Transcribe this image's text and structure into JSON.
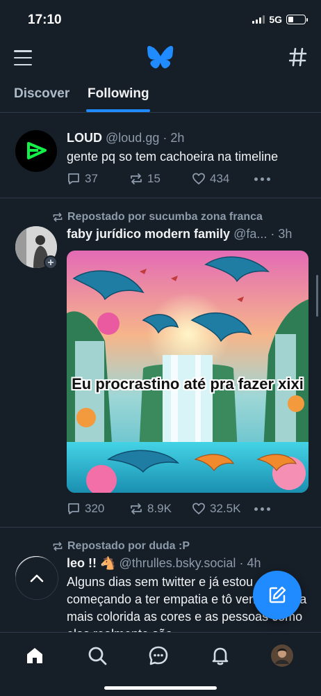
{
  "status_bar": {
    "time": "17:10",
    "network": "5G",
    "battery_level": 0.3
  },
  "header": {
    "menu_icon": "menu-icon",
    "logo_icon": "butterfly-icon",
    "feeds_icon": "hash-icon"
  },
  "tabs": [
    {
      "label": "Discover",
      "active": false
    },
    {
      "label": "Following",
      "active": true
    }
  ],
  "posts": [
    {
      "display_name": "LOUD",
      "handle": "@loud.gg",
      "time": "· 2h",
      "text": "gente pq so tem cachoeira na timeline",
      "replies": "37",
      "reposts": "15",
      "likes": "434"
    },
    {
      "repost_label": "Repostado por sucumba zona franca",
      "display_name": "faby jurídico modern family",
      "handle": "@fa...",
      "time": "· 3h",
      "image_caption": "Eu procrastino até pra fazer xixi",
      "replies": "320",
      "reposts": "8.9K",
      "likes": "32.5K"
    },
    {
      "repost_label": "Repostado por duda :P",
      "display_name": "leo !! 🐴",
      "handle": "@thrulles.bsky.social",
      "time": "· 4h",
      "text": "Alguns dias sem twitter e já estou começando a ter empatia e tô vendo a vida mais colorida as cores e as pessoas como elas realmente são"
    }
  ],
  "colors": {
    "accent": "#208bfe",
    "background": "#161e27",
    "muted": "#8d9bab"
  },
  "bottom_nav": [
    "home-icon",
    "search-icon",
    "chat-icon",
    "bell-icon",
    "profile-avatar"
  ]
}
